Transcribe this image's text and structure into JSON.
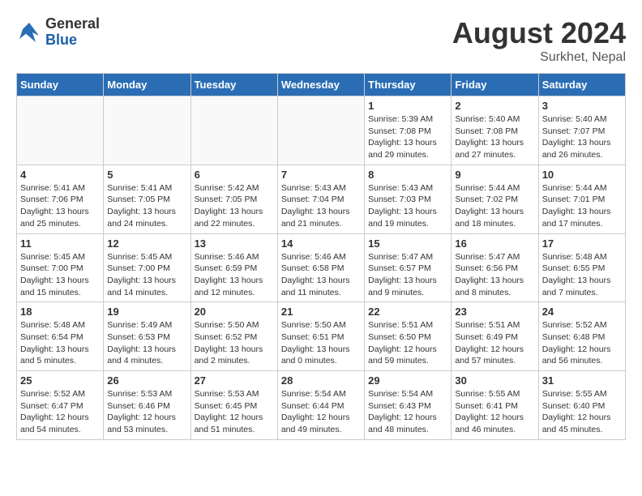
{
  "logo": {
    "general": "General",
    "blue": "Blue"
  },
  "title": {
    "month_year": "August 2024",
    "location": "Surkhet, Nepal"
  },
  "weekdays": [
    "Sunday",
    "Monday",
    "Tuesday",
    "Wednesday",
    "Thursday",
    "Friday",
    "Saturday"
  ],
  "weeks": [
    [
      {
        "day": "",
        "info": ""
      },
      {
        "day": "",
        "info": ""
      },
      {
        "day": "",
        "info": ""
      },
      {
        "day": "",
        "info": ""
      },
      {
        "day": "1",
        "info": "Sunrise: 5:39 AM\nSunset: 7:08 PM\nDaylight: 13 hours\nand 29 minutes."
      },
      {
        "day": "2",
        "info": "Sunrise: 5:40 AM\nSunset: 7:08 PM\nDaylight: 13 hours\nand 27 minutes."
      },
      {
        "day": "3",
        "info": "Sunrise: 5:40 AM\nSunset: 7:07 PM\nDaylight: 13 hours\nand 26 minutes."
      }
    ],
    [
      {
        "day": "4",
        "info": "Sunrise: 5:41 AM\nSunset: 7:06 PM\nDaylight: 13 hours\nand 25 minutes."
      },
      {
        "day": "5",
        "info": "Sunrise: 5:41 AM\nSunset: 7:05 PM\nDaylight: 13 hours\nand 24 minutes."
      },
      {
        "day": "6",
        "info": "Sunrise: 5:42 AM\nSunset: 7:05 PM\nDaylight: 13 hours\nand 22 minutes."
      },
      {
        "day": "7",
        "info": "Sunrise: 5:43 AM\nSunset: 7:04 PM\nDaylight: 13 hours\nand 21 minutes."
      },
      {
        "day": "8",
        "info": "Sunrise: 5:43 AM\nSunset: 7:03 PM\nDaylight: 13 hours\nand 19 minutes."
      },
      {
        "day": "9",
        "info": "Sunrise: 5:44 AM\nSunset: 7:02 PM\nDaylight: 13 hours\nand 18 minutes."
      },
      {
        "day": "10",
        "info": "Sunrise: 5:44 AM\nSunset: 7:01 PM\nDaylight: 13 hours\nand 17 minutes."
      }
    ],
    [
      {
        "day": "11",
        "info": "Sunrise: 5:45 AM\nSunset: 7:00 PM\nDaylight: 13 hours\nand 15 minutes."
      },
      {
        "day": "12",
        "info": "Sunrise: 5:45 AM\nSunset: 7:00 PM\nDaylight: 13 hours\nand 14 minutes."
      },
      {
        "day": "13",
        "info": "Sunrise: 5:46 AM\nSunset: 6:59 PM\nDaylight: 13 hours\nand 12 minutes."
      },
      {
        "day": "14",
        "info": "Sunrise: 5:46 AM\nSunset: 6:58 PM\nDaylight: 13 hours\nand 11 minutes."
      },
      {
        "day": "15",
        "info": "Sunrise: 5:47 AM\nSunset: 6:57 PM\nDaylight: 13 hours\nand 9 minutes."
      },
      {
        "day": "16",
        "info": "Sunrise: 5:47 AM\nSunset: 6:56 PM\nDaylight: 13 hours\nand 8 minutes."
      },
      {
        "day": "17",
        "info": "Sunrise: 5:48 AM\nSunset: 6:55 PM\nDaylight: 13 hours\nand 7 minutes."
      }
    ],
    [
      {
        "day": "18",
        "info": "Sunrise: 5:48 AM\nSunset: 6:54 PM\nDaylight: 13 hours\nand 5 minutes."
      },
      {
        "day": "19",
        "info": "Sunrise: 5:49 AM\nSunset: 6:53 PM\nDaylight: 13 hours\nand 4 minutes."
      },
      {
        "day": "20",
        "info": "Sunrise: 5:50 AM\nSunset: 6:52 PM\nDaylight: 13 hours\nand 2 minutes."
      },
      {
        "day": "21",
        "info": "Sunrise: 5:50 AM\nSunset: 6:51 PM\nDaylight: 13 hours\nand 0 minutes."
      },
      {
        "day": "22",
        "info": "Sunrise: 5:51 AM\nSunset: 6:50 PM\nDaylight: 12 hours\nand 59 minutes."
      },
      {
        "day": "23",
        "info": "Sunrise: 5:51 AM\nSunset: 6:49 PM\nDaylight: 12 hours\nand 57 minutes."
      },
      {
        "day": "24",
        "info": "Sunrise: 5:52 AM\nSunset: 6:48 PM\nDaylight: 12 hours\nand 56 minutes."
      }
    ],
    [
      {
        "day": "25",
        "info": "Sunrise: 5:52 AM\nSunset: 6:47 PM\nDaylight: 12 hours\nand 54 minutes."
      },
      {
        "day": "26",
        "info": "Sunrise: 5:53 AM\nSunset: 6:46 PM\nDaylight: 12 hours\nand 53 minutes."
      },
      {
        "day": "27",
        "info": "Sunrise: 5:53 AM\nSunset: 6:45 PM\nDaylight: 12 hours\nand 51 minutes."
      },
      {
        "day": "28",
        "info": "Sunrise: 5:54 AM\nSunset: 6:44 PM\nDaylight: 12 hours\nand 49 minutes."
      },
      {
        "day": "29",
        "info": "Sunrise: 5:54 AM\nSunset: 6:43 PM\nDaylight: 12 hours\nand 48 minutes."
      },
      {
        "day": "30",
        "info": "Sunrise: 5:55 AM\nSunset: 6:41 PM\nDaylight: 12 hours\nand 46 minutes."
      },
      {
        "day": "31",
        "info": "Sunrise: 5:55 AM\nSunset: 6:40 PM\nDaylight: 12 hours\nand 45 minutes."
      }
    ]
  ]
}
